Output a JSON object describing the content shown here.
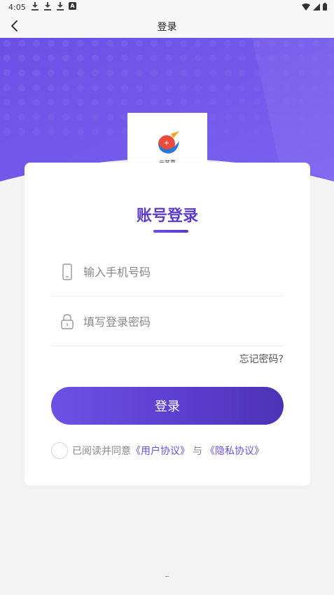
{
  "status_bar": {
    "time": "4:05",
    "a_badge": "A"
  },
  "nav": {
    "title": "登录"
  },
  "logo": {
    "text": "云艺嘉"
  },
  "card": {
    "title": "账号登录",
    "phone_placeholder": "输入手机号码",
    "password_placeholder": "填写登录密码",
    "forgot_label": "忘记密码?",
    "login_label": "登录",
    "agree_prefix": "已阅读并同意",
    "user_agreement": "《用户协议》",
    "agree_and": "与",
    "privacy_policy": "《隐私协议》"
  },
  "colors": {
    "accent": "#6a4fd9",
    "hero_purple": "#6d52e8"
  }
}
